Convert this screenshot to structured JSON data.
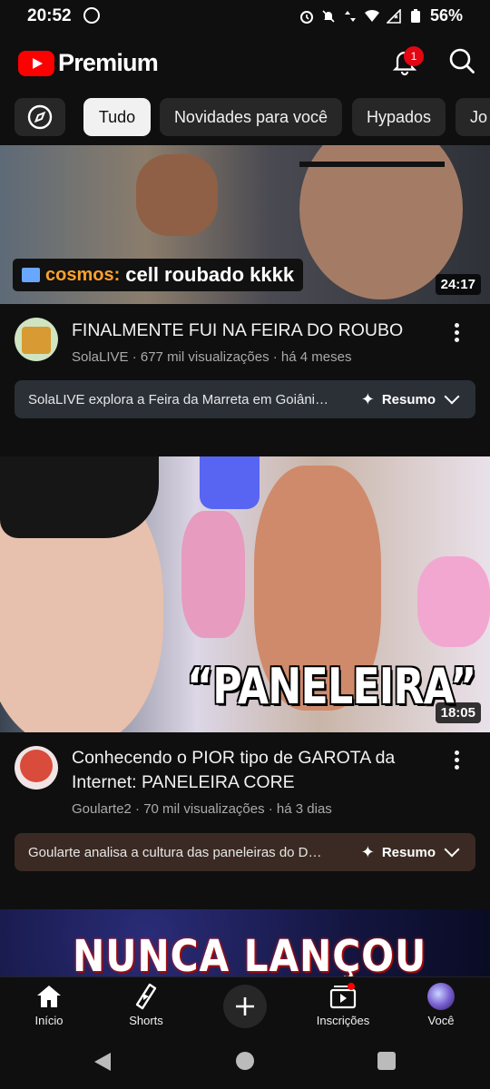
{
  "status": {
    "time": "20:52",
    "battery": "56%"
  },
  "header": {
    "brand": "Premium",
    "notification_count": "1"
  },
  "chips": [
    {
      "label": "",
      "icon": "explore-icon"
    },
    {
      "label": "Tudo"
    },
    {
      "label": "Novidades para você"
    },
    {
      "label": "Hypados"
    },
    {
      "label": "Jo"
    }
  ],
  "videos": [
    {
      "thumb_caption_brand": "cosmos:",
      "thumb_caption": "cell roubado kkkk",
      "duration": "24:17",
      "title": "FINALMENTE FUI NA FEIRA DO ROUBO",
      "meta": "SolaLIVE · 677 mil visualizações · há 4 meses",
      "summary": "SolaLIVE explora a Feira da Marreta em Goiâni…",
      "summary_label": "Resumo"
    },
    {
      "thumb_caption": "“PANELEIRA”",
      "duration": "18:05",
      "title": "Conhecendo o PIOR tipo de GAROTA da Internet: PANELEIRA CORE",
      "meta": "Goularte2 · 70 mil visualizações · há 3 dias",
      "summary": "Goularte analisa a cultura das paneleiras do D…",
      "summary_label": "Resumo"
    },
    {
      "thumb_caption": "NUNCA LANÇOU"
    }
  ],
  "bottom_nav": [
    {
      "label": "Início",
      "icon": "home-icon"
    },
    {
      "label": "Shorts",
      "icon": "shorts-icon"
    },
    {
      "label": "",
      "icon": "create-icon"
    },
    {
      "label": "Inscrições",
      "icon": "subscriptions-icon"
    },
    {
      "label": "Você",
      "icon": "avatar-icon"
    }
  ],
  "colors": {
    "background": "#0f0f0f",
    "chip": "#272727",
    "brand_red": "#ff0000",
    "summary1": "#2b3037",
    "summary2": "#3b2a23"
  }
}
